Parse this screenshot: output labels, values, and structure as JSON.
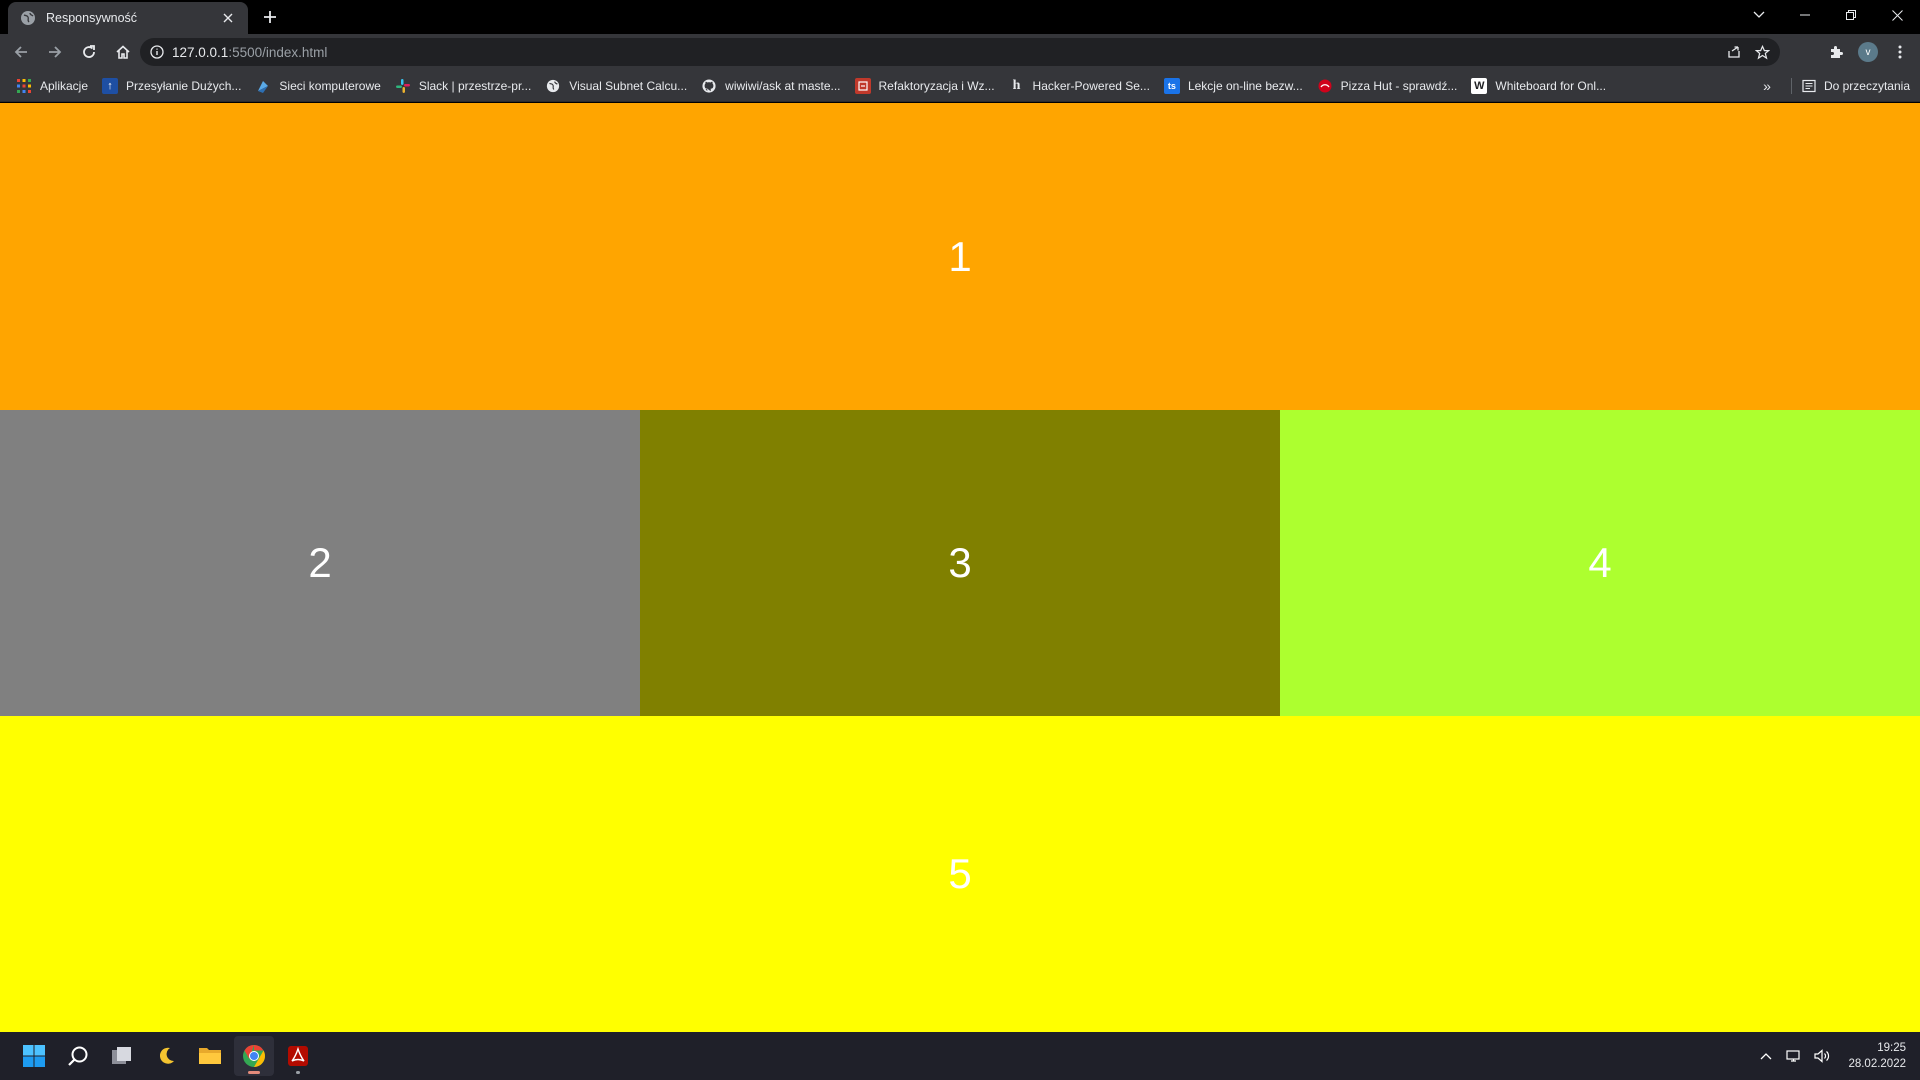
{
  "browser": {
    "tab": {
      "title": "Responsywność"
    },
    "address": {
      "host": "127.0.0.1",
      "path": ":5500/index.html"
    },
    "profile_initial": "v"
  },
  "bookmarks": {
    "items": [
      {
        "label": "Aplikacje",
        "icon": "apps-grid-icon"
      },
      {
        "label": "Przesyłanie Dużych...",
        "icon": "upload-icon"
      },
      {
        "label": "Sieci komputerowe",
        "icon": "network-icon"
      },
      {
        "label": "Slack | przestrze-pr...",
        "icon": "slack-icon"
      },
      {
        "label": "Visual Subnet Calcu...",
        "icon": "globe-icon"
      },
      {
        "label": "wiwiwi/ask at maste...",
        "icon": "github-icon"
      },
      {
        "label": "Refaktoryzacja i Wz...",
        "icon": "refactoring-icon"
      },
      {
        "label": "Hacker-Powered Se...",
        "icon": "hackerone-icon"
      },
      {
        "label": "Lekcje on-line bezw...",
        "icon": "ts-icon"
      },
      {
        "label": "Pizza Hut - sprawdź...",
        "icon": "pizza-hut-icon"
      },
      {
        "label": "Whiteboard for Onl...",
        "icon": "whiteboard-icon"
      }
    ],
    "more": "»",
    "reading_list": "Do przeczytania"
  },
  "content": {
    "blocks": [
      {
        "label": "1",
        "color": "#FFA500"
      },
      {
        "label": "2",
        "color": "#808080"
      },
      {
        "label": "3",
        "color": "#808000"
      },
      {
        "label": "4",
        "color": "#ADFF2F"
      },
      {
        "label": "5",
        "color": "#FFFF00"
      }
    ]
  },
  "taskbar": {
    "apps": [
      "start-icon",
      "search-icon",
      "task-view-icon",
      "night-light-icon",
      "file-explorer-icon",
      "chrome-icon",
      "acrobat-icon"
    ],
    "time": "19:25",
    "date": "28.02.2022"
  }
}
